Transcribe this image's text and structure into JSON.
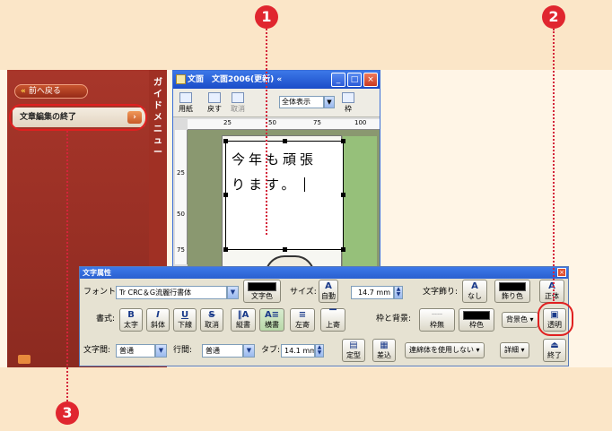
{
  "callouts": {
    "c1": "1",
    "c2": "2",
    "c3": "3"
  },
  "guide": {
    "back_label": "前へ戻る",
    "end_edit_label": "文章編集の終了",
    "tab_label": "ガイドメニュー"
  },
  "doc": {
    "title": "文面　文面2006(更新) «",
    "tools": [
      "用紙",
      "戻す",
      "取消",
      "枠"
    ],
    "view_select": "全体表示",
    "ruler_marks": [
      "25",
      "50",
      "75",
      "100"
    ],
    "ruler_v_marks": [
      "25",
      "50",
      "75"
    ],
    "text_line1": "今年も頑張",
    "text_line2": "ります。"
  },
  "attr_panel": {
    "title": "文字属性",
    "font_label": "フォント:",
    "font_value": "Tr CRC＆G流麗行書体",
    "text_color_label": "文字色",
    "size_label": "サイズ:",
    "size_auto": "自動",
    "size_value": "14.7 mm",
    "deco_label": "文字飾り:",
    "deco_none": "なし",
    "deco_color": "飾り色",
    "upright": "正体",
    "style_label": "書式:",
    "bold": "太字",
    "italic": "斜体",
    "underline": "下線",
    "strike": "取消",
    "vertical": "縦書",
    "horizontal": "横書",
    "align_left": "左寄",
    "align_top": "上寄",
    "frame_bg_label": "枠と背景:",
    "frame_none": "枠無",
    "frame_color": "枠色",
    "bg_color": "背景色",
    "transparent": "透明",
    "char_spacing_label": "文字間:",
    "char_spacing_value": "普通",
    "line_spacing_label": "行間:",
    "line_spacing_value": "普通",
    "tab_label": "タブ:",
    "tab_value": "14.1 mm",
    "fixed": "定型",
    "insert": "差込",
    "ligature": "連綿体を使用しない",
    "detail": "詳細",
    "finish": "終了"
  }
}
